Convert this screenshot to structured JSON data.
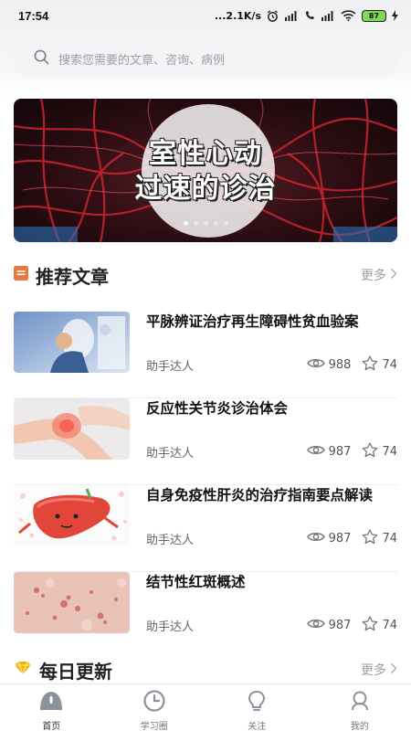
{
  "status_bar": {
    "time": "17:54",
    "net_speed": "...2.1K/s",
    "battery": "87"
  },
  "search": {
    "placeholder": "搜索您需要的文章、咨询、病例"
  },
  "banner": {
    "title": "室性心动\n过速的诊治",
    "slide_count": 5,
    "active_slide": 1
  },
  "recommended": {
    "title": "推荐文章",
    "more_label": "更多",
    "articles": [
      {
        "title": "平脉辨证治疗再生障碍性贫血验案",
        "author": "助手达人",
        "views": "988",
        "favorites": "74"
      },
      {
        "title": "反应性关节炎诊治体会",
        "author": "助手达人",
        "views": "987",
        "favorites": "74"
      },
      {
        "title": "自身免疫性肝炎的治疗指南要点解读",
        "author": "助手达人",
        "views": "987",
        "favorites": "74"
      },
      {
        "title": "结节性红斑概述",
        "author": "助手达人",
        "views": "987",
        "favorites": "74"
      }
    ]
  },
  "daily": {
    "title": "每日更新",
    "more_label": "更多"
  },
  "tabbar": {
    "items": [
      {
        "label": "首页",
        "icon": "home-icon",
        "active": true
      },
      {
        "label": "学习圈",
        "icon": "clock-icon",
        "active": false
      },
      {
        "label": "关注",
        "icon": "lightbulb-icon",
        "active": false
      },
      {
        "label": "我的",
        "icon": "user-icon",
        "active": false
      }
    ]
  },
  "colors": {
    "accent_orange": "#e8773a",
    "accent_yellow": "#f2b705",
    "text_dark": "#222222",
    "text_muted": "#9a9ea5"
  }
}
